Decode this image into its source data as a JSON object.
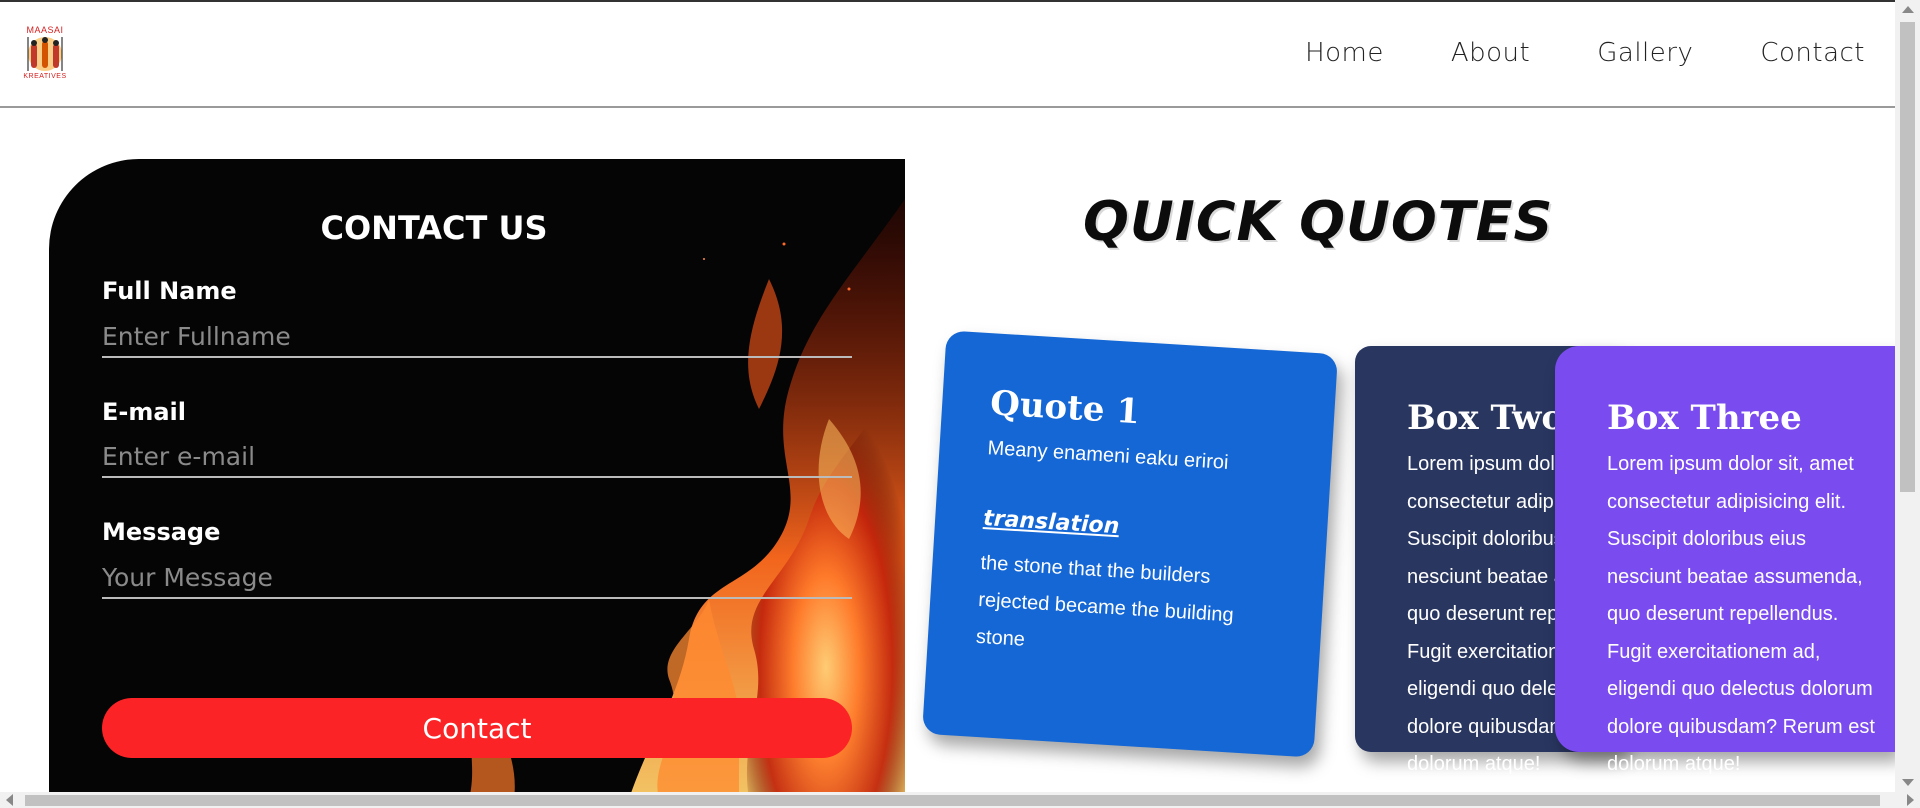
{
  "brand": {
    "line1": "MAASAI",
    "line2": "KREATIVES"
  },
  "nav": {
    "home": "Home",
    "about": "About",
    "gallery": "Gallery",
    "contact": "Contact"
  },
  "contact_form": {
    "title": "CONTACT US",
    "name_label": "Full Name",
    "name_placeholder": "Enter Fullname",
    "email_label": "E-mail",
    "email_placeholder": "Enter e-mail",
    "message_label": "Message",
    "message_placeholder": "Your Message",
    "submit_label": "Contact",
    "submit_color": "#fb2325"
  },
  "quotes": {
    "title": "QUICK QUOTES",
    "box1": {
      "heading": "Quote 1",
      "quote": "Meany enameni eaku eriroi",
      "translation_label": "translation",
      "translation_text": "the stone that the builders rejected became the building stone",
      "color": "#1467d5"
    },
    "box2": {
      "heading": "Box Two",
      "text": "Lorem ipsum dolor sit, amet\nconsectetur adipisicing elit.\nSuscipit doloribus eius\nnesciunt beatae assumenda,\nquo deserunt repellendus.\nFugit exercitationem ad,\neligendi quo delectus dolorum\ndolore quibusdam? Rerum est\ndolorum atque!",
      "color": "#293660"
    },
    "box3": {
      "heading": "Box Three",
      "text": "Lorem ipsum dolor sit, amet\nconsectetur adipisicing elit.\nSuscipit doloribus eius\nnesciunt beatae assumenda,\nquo deserunt repellendus.\nFugit exercitationem ad,\neligendi quo delectus dolorum\ndolore quibusdam? Rerum est\ndolorum atque!",
      "color": "#7a4bef"
    }
  }
}
